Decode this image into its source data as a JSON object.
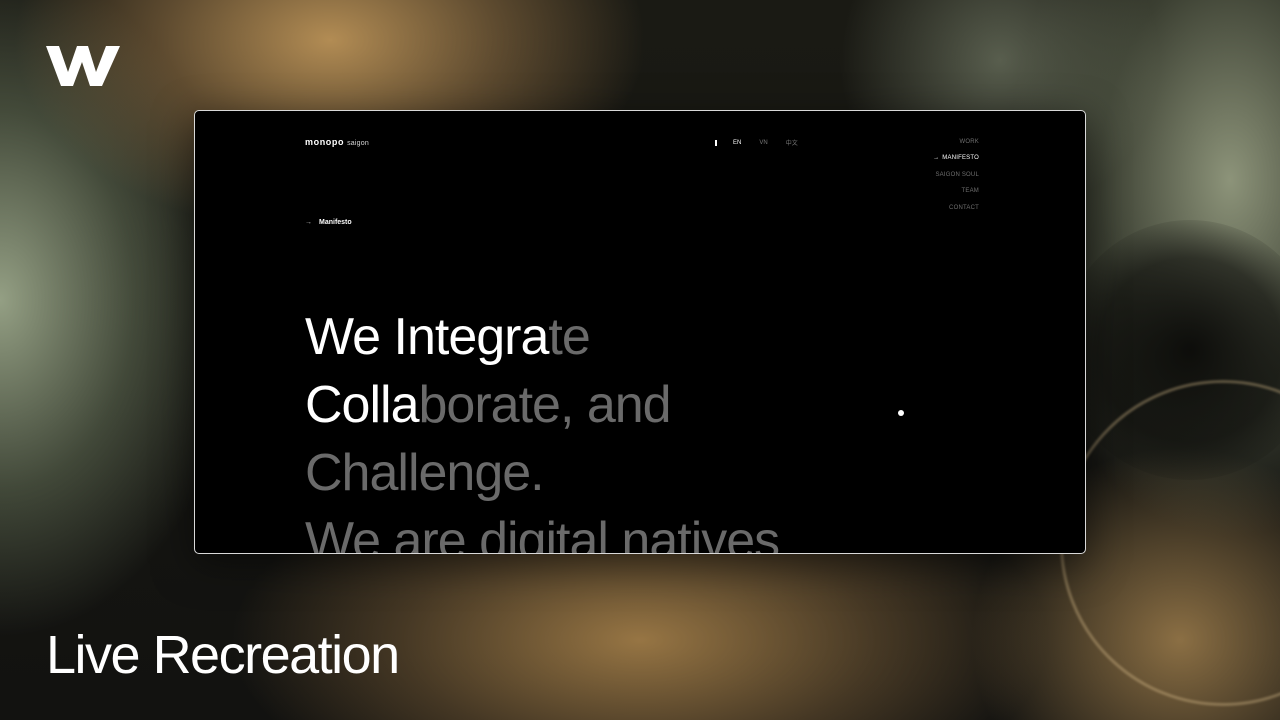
{
  "colors": {
    "window_bg": "#000000",
    "text_primary": "#ffffff",
    "text_dim": "#6a6a6a",
    "nav_inactive": "#6f6f6f"
  },
  "branding": {
    "logo_icon": "webflow-w-logo-icon"
  },
  "caption": "Live Recreation",
  "site": {
    "brand": "monopo",
    "brand_sub": "saigon",
    "languages": [
      {
        "label": "EN",
        "active": true
      },
      {
        "label": "VN",
        "active": false
      },
      {
        "label": "中文",
        "active": false
      }
    ],
    "nav_arrow": "→",
    "nav": [
      {
        "label": "WORK",
        "active": false
      },
      {
        "label": "MANIFESTO",
        "active": true
      },
      {
        "label": "SAIGON SOUL",
        "active": false
      },
      {
        "label": "TEAM",
        "active": false
      },
      {
        "label": "CONTACT",
        "active": false
      }
    ],
    "breadcrumb": {
      "arrow": "→",
      "label": "Manifesto"
    },
    "hero": {
      "line1_lit": "We Integra",
      "line1_dim": "te",
      "line2_lit": "Colla",
      "line2_dim": "borate, and",
      "line3_dim": "Challenge.",
      "line4_dim": "We are digital natives"
    }
  }
}
